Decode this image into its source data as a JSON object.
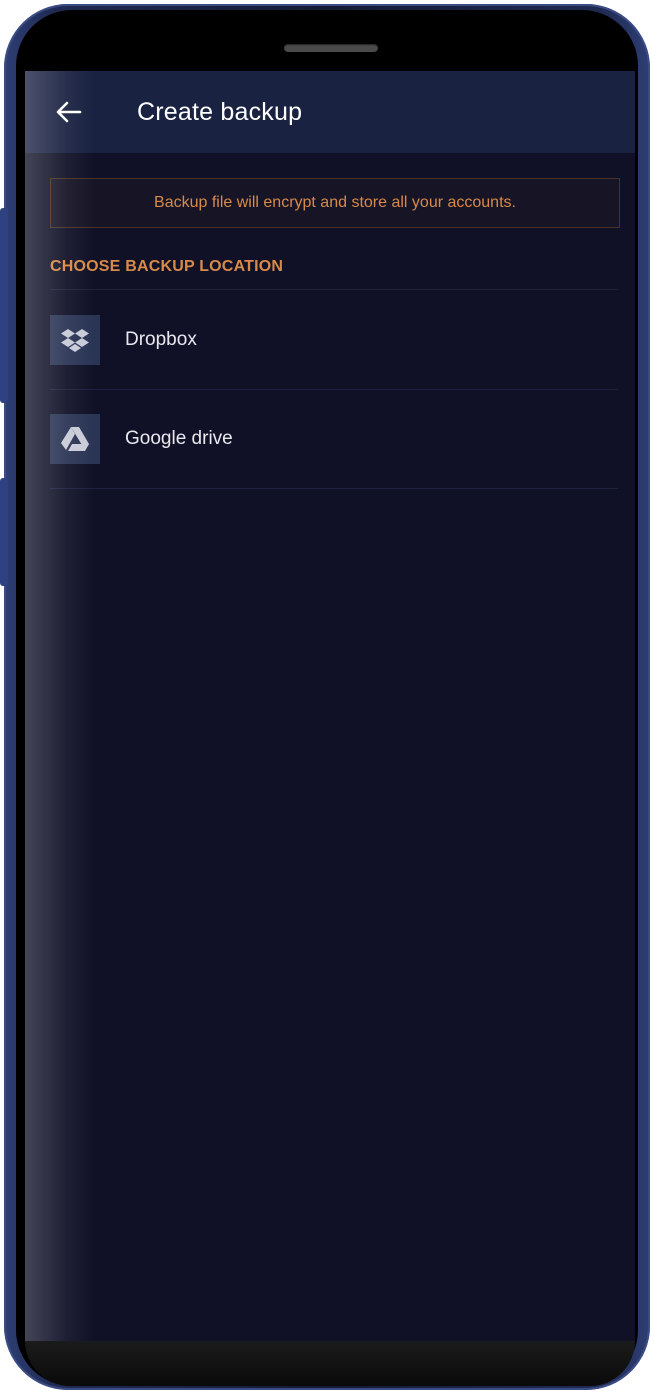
{
  "app_bar": {
    "title": "Create backup",
    "back_icon": "arrow-left-icon"
  },
  "info_banner": {
    "text": "Backup file will encrypt and store all your accounts."
  },
  "section": {
    "heading": "CHOOSE BACKUP LOCATION"
  },
  "locations": [
    {
      "label": "Dropbox",
      "icon": "dropbox-icon"
    },
    {
      "label": "Google drive",
      "icon": "google-drive-icon"
    }
  ],
  "colors": {
    "background": "#101127",
    "app_bar": "#1a2242",
    "accent": "#d88a48",
    "icon_tile": "#2a3454",
    "text": "#e8e8ee"
  }
}
